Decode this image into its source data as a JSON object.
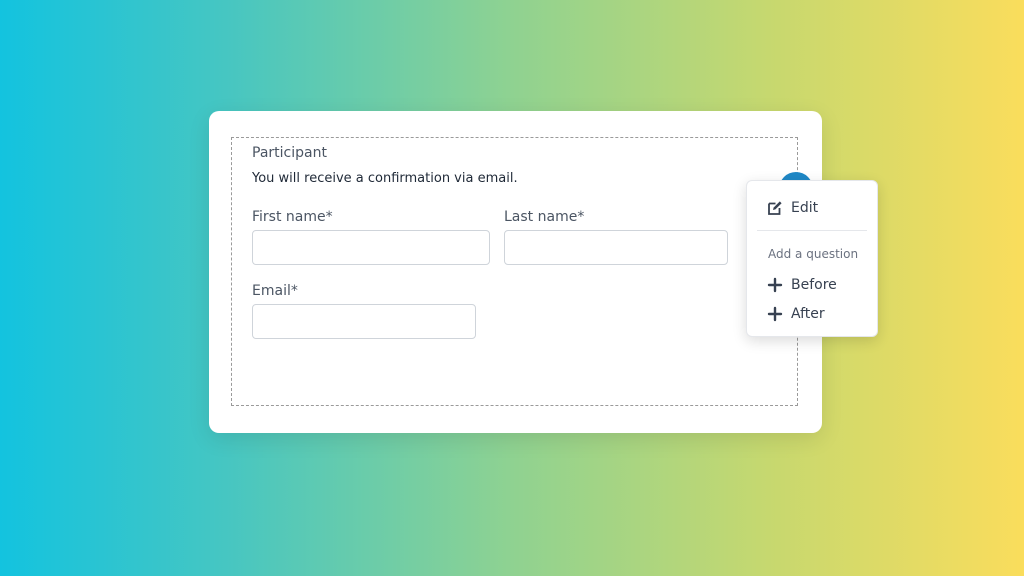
{
  "form": {
    "section_title": "Participant",
    "section_description": "You will receive a confirmation via email.",
    "fields": {
      "first_name": {
        "label": "First name*",
        "value": ""
      },
      "last_name": {
        "label": "Last name*",
        "value": ""
      },
      "email": {
        "label": "Email*",
        "value": ""
      }
    }
  },
  "toolbar": {
    "more_icon": "more-vertical-icon",
    "accent_color": "#1f88c6"
  },
  "menu": {
    "edit_label": "Edit",
    "edit_icon": "edit-icon",
    "add_heading": "Add a question",
    "before_label": "Before",
    "after_label": "After",
    "add_icon": "plus-icon"
  }
}
